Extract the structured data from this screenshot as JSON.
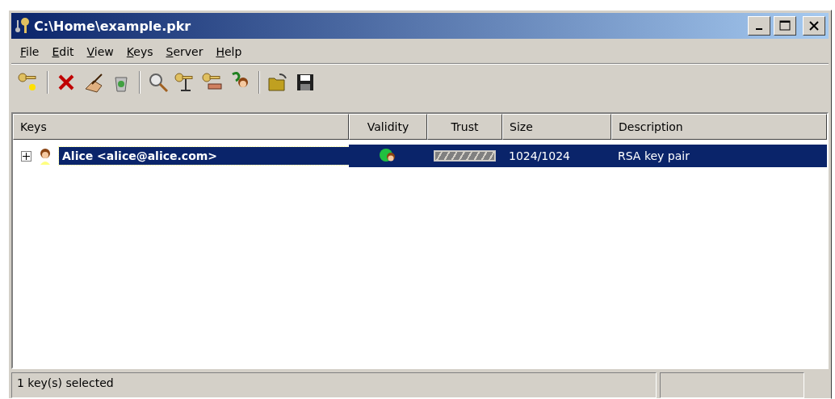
{
  "window": {
    "title": "C:\\Home\\example.pkr"
  },
  "menu": [
    {
      "accel": "F",
      "rest": "ile"
    },
    {
      "accel": "E",
      "rest": "dit"
    },
    {
      "accel": "V",
      "rest": "iew"
    },
    {
      "accel": "K",
      "rest": "eys"
    },
    {
      "accel": "S",
      "rest": "erver"
    },
    {
      "accel": "H",
      "rest": "elp"
    }
  ],
  "table": {
    "columns": [
      "Keys",
      "Validity",
      "Trust",
      "Size",
      "Description"
    ],
    "rows": [
      {
        "name": "Alice <alice@alice.com>",
        "expanded": false,
        "selected": true,
        "trust": {
          "level": 1
        },
        "size": "1024/1024",
        "description": "RSA key pair"
      }
    ]
  },
  "status_bar": {
    "text": "1 key(s) selected"
  }
}
